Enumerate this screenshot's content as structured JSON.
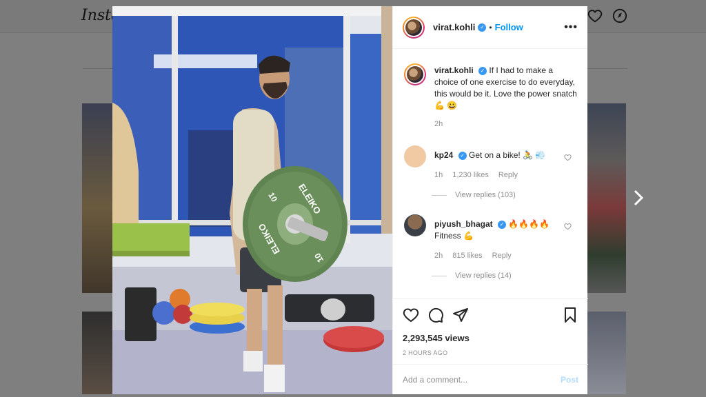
{
  "background": {
    "logo_text": "Insta",
    "icons": [
      "heart-icon",
      "compass-icon"
    ],
    "next_icon": "chevron-right-icon"
  },
  "post": {
    "username": "virat.kohli",
    "follow_label": "Follow",
    "dot": "•",
    "more_label": "•••",
    "caption_text": "If I had to make a choice of one exercise to do everyday, this would be it. Love the power snatch 💪 😀",
    "caption_time": "2h",
    "views": "2,293,545 views",
    "posted_ago": "2 HOURS AGO"
  },
  "media": {
    "plate_text": "ELEIKO",
    "plate_number": "10"
  },
  "comments": [
    {
      "username": "kp24",
      "text": "Get on a bike! 🚴 💨",
      "time": "1h",
      "likes": "1,230 likes",
      "reply_label": "Reply",
      "view_replies": "View replies (103)"
    },
    {
      "username": "piyush_bhagat",
      "text": "🔥🔥🔥🔥 Fitness 💪",
      "time": "2h",
      "likes": "815 likes",
      "reply_label": "Reply",
      "view_replies": "View replies (14)"
    }
  ],
  "comment_input": {
    "placeholder": "Add a comment...",
    "post_label": "Post"
  },
  "colors": {
    "accent": "#0095f6",
    "verified": "#3897f0",
    "post_disabled": "#b3dbff",
    "plate_green": "#6a8f5a"
  }
}
